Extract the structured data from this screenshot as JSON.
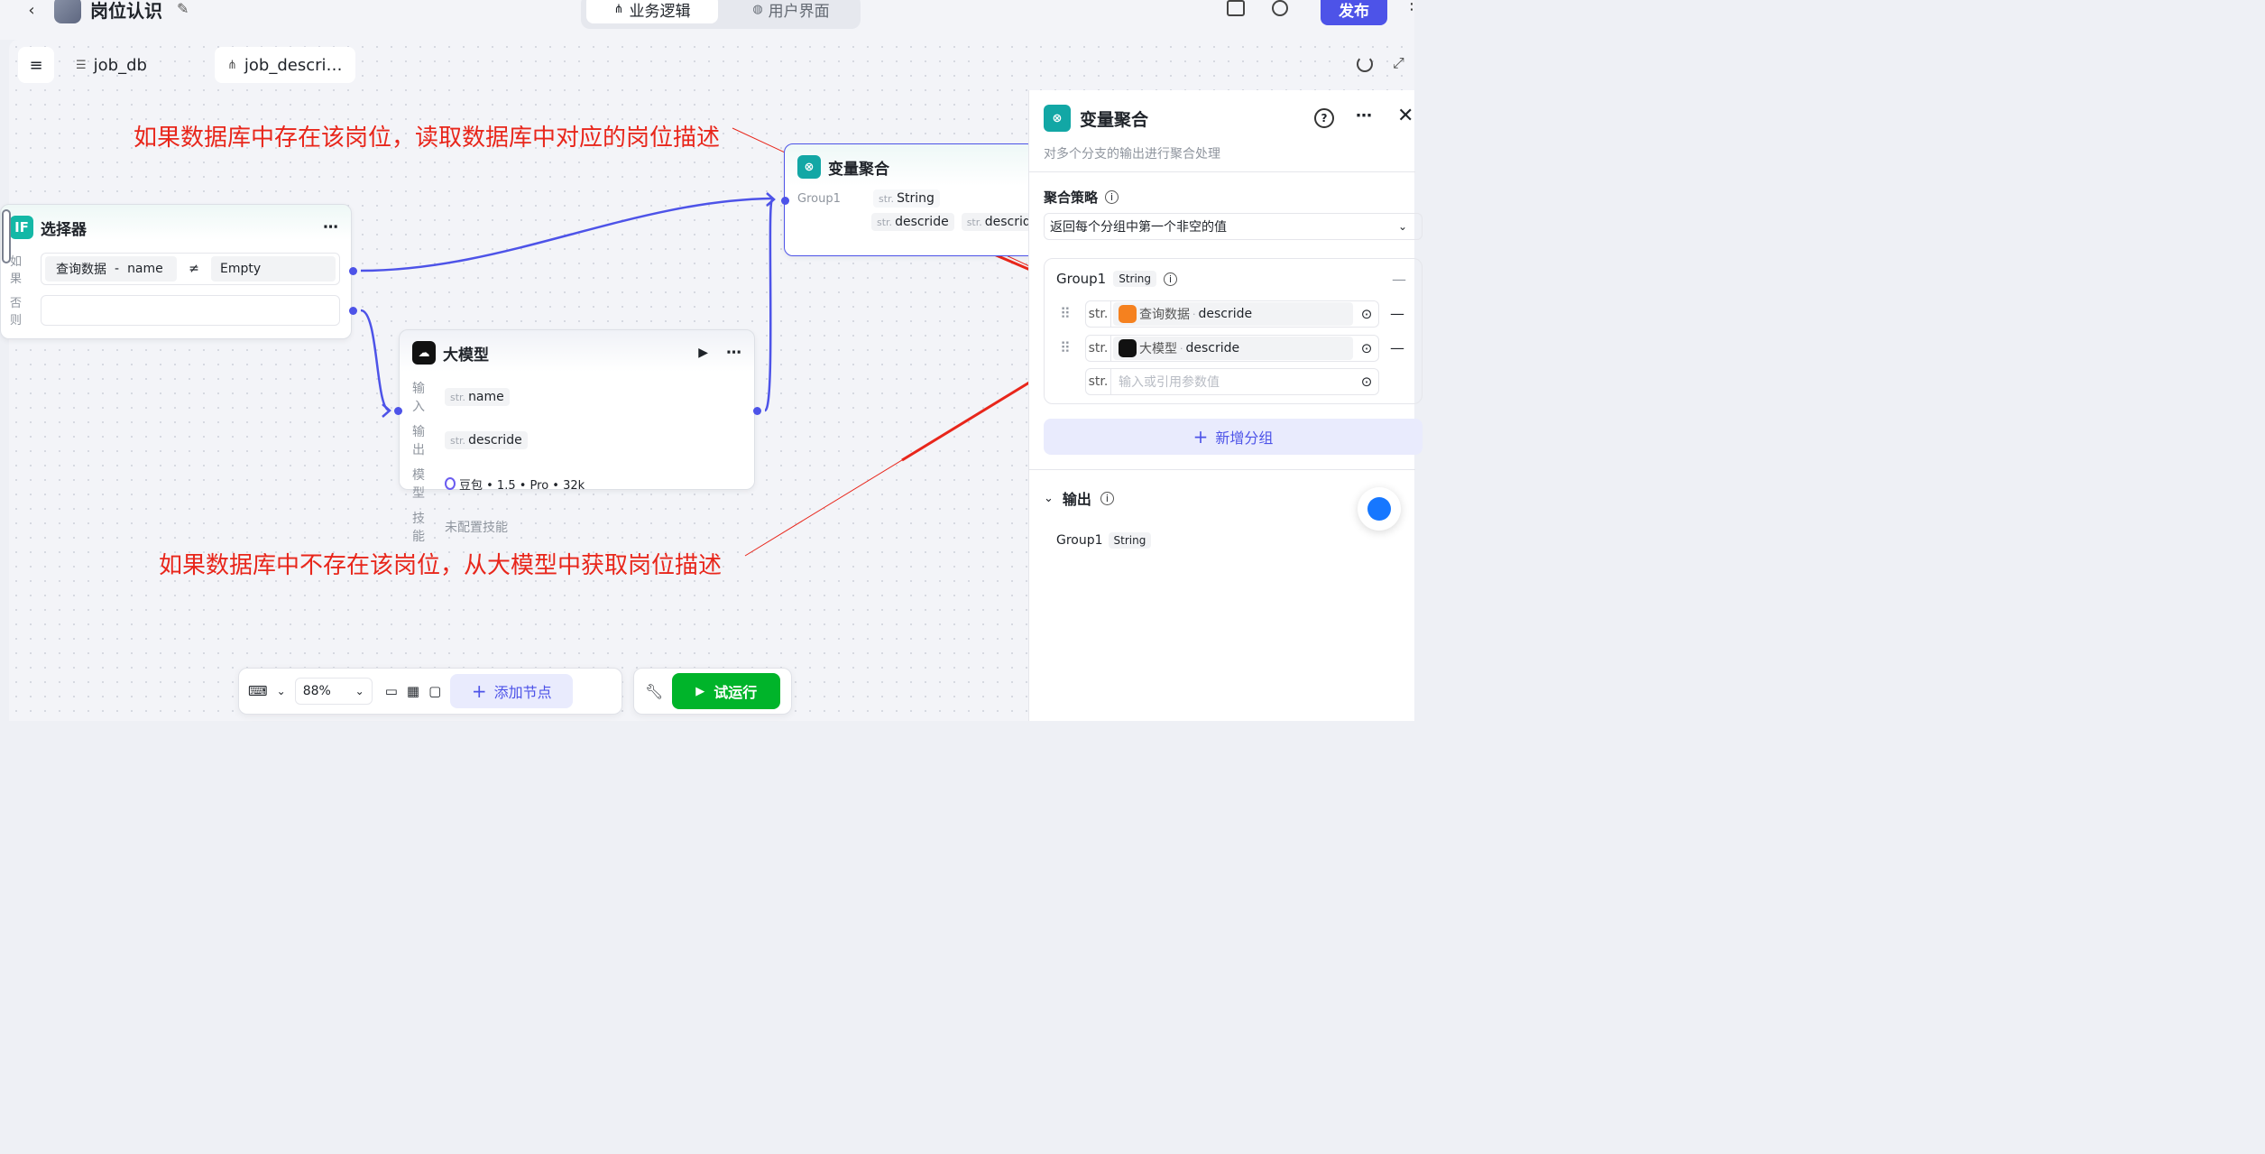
{
  "app": {
    "title": "岗位认识",
    "publish_label": "发布"
  },
  "mode_tabs": [
    {
      "label": "业务逻辑",
      "active": true
    },
    {
      "label": "用户界面",
      "active": false
    }
  ],
  "file_tabs": [
    {
      "label": "job_db"
    },
    {
      "label": "job_descri…"
    }
  ],
  "annotations": {
    "top": "如果数据库中存在该岗位，读取数据库中对应的岗位描述",
    "bottom": "如果数据库中不存在该岗位，从大模型中获取岗位描述"
  },
  "selector_node": {
    "icon": "IF",
    "title": "选择器",
    "if_label": "如果",
    "else_label": "否则",
    "cond_left_a": "查询数据",
    "cond_left_sep": "-",
    "cond_left_b": "name",
    "cond_op": "≠",
    "cond_right": "Empty"
  },
  "llm_node": {
    "title": "大模型",
    "input_label": "输入",
    "input_var": "name",
    "output_label": "输出",
    "output_var": "descride",
    "model_label": "模型",
    "model_value": "豆包 • 1.5 • Pro • 32k",
    "skill_label": "技能",
    "skill_value": "未配置技能",
    "str_prefix": "str."
  },
  "agg_node": {
    "title": "变量聚合",
    "group": "Group1",
    "type": "String",
    "var1": "descride",
    "var2": "descride",
    "str_prefix": "str."
  },
  "panel": {
    "title": "变量聚合",
    "desc": "对多个分支的输出进行聚合处理",
    "strategy_label": "聚合策略",
    "strategy_value": "返回每个分组中第一个非空的值",
    "group_name": "Group1",
    "group_type": "String",
    "str_prefix": "str.",
    "items": [
      {
        "source": "查询数据",
        "var": "descride",
        "color": "#f5811f"
      },
      {
        "source": "大模型",
        "var": "descride",
        "color": "#111111"
      }
    ],
    "input_placeholder": "输入或引用参数值",
    "add_group_label": "新增分组",
    "output_label": "输出",
    "output_group": "Group1",
    "output_type": "String"
  },
  "bottom_toolbar": {
    "zoom": "88%",
    "add_node_label": "添加节点",
    "run_label": "试运行"
  },
  "colors": {
    "accent": "#4d53e8",
    "edge": "#4d53e8",
    "annotation": "#e8261b",
    "run": "#00b42a",
    "agg_icon": "#12a7a5"
  }
}
